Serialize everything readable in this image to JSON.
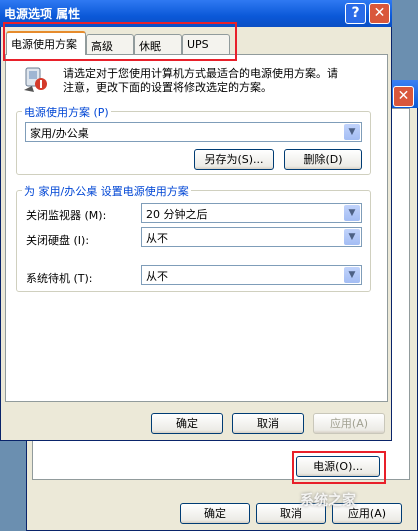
{
  "dialog": {
    "title": "电源选项 属性",
    "help_glyph": "?",
    "close_glyph": "✕",
    "tabs": [
      {
        "label": "电源使用方案",
        "selected": true
      },
      {
        "label": "高级",
        "selected": false
      },
      {
        "label": "休眠",
        "selected": false
      },
      {
        "label": "UPS",
        "selected": false
      }
    ],
    "intro_line1": "请选定对于您使用计算机方式最适合的电源使用方案。请",
    "intro_line2": "注意，更改下面的设置将修改选定的方案。",
    "scheme_group_label": "电源使用方案 (P)",
    "scheme_value": "家用/办公桌",
    "save_as_label": "另存为(S)...",
    "delete_label": "删除(D)",
    "settings_group_label": "为 家用/办公桌 设置电源使用方案",
    "settings": [
      {
        "label": "关闭监视器 (M):",
        "value": "20 分钟之后"
      },
      {
        "label": "关闭硬盘 (I):",
        "value": "从不"
      },
      {
        "label": "系统待机 (T):",
        "value": "从不"
      }
    ],
    "ok_label": "确定",
    "cancel_label": "取消",
    "apply_label": "应用(A)"
  },
  "background_window": {
    "close_glyph": "✕",
    "power_button_label": "电源(O)...",
    "ok_label": "确定",
    "cancel_label": "取消",
    "apply_label": "应用(A)"
  },
  "watermark": "系统之家",
  "colors": {
    "titlebar": "#0b58d8",
    "highlight": "#e8202a",
    "tab_accent": "#e68b2c",
    "group_label": "#0046d5"
  }
}
